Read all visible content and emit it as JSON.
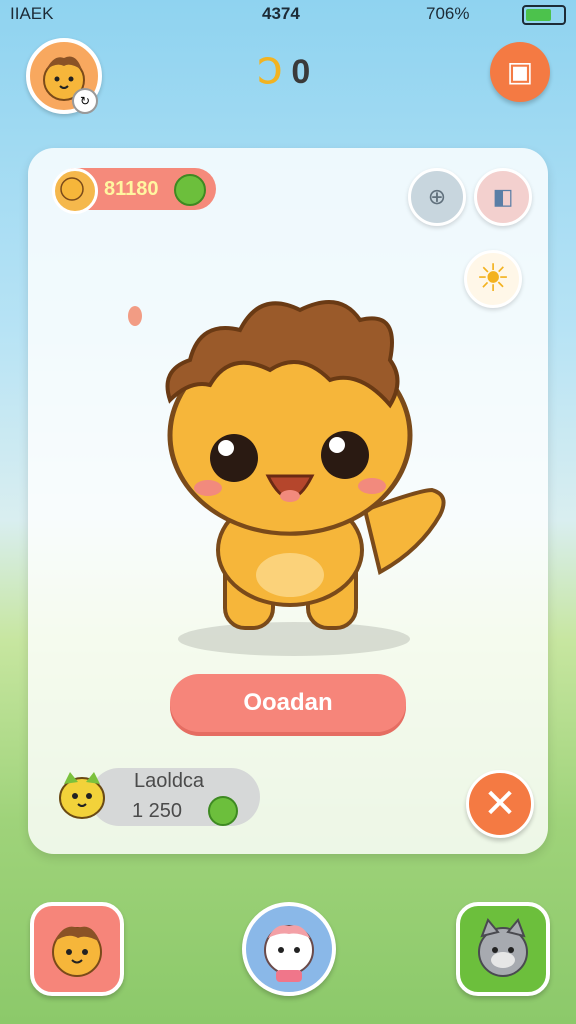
{
  "status_bar": {
    "carrier": "IIAEK",
    "time": "4374",
    "battery": "706%",
    "battery_level": 0.7
  },
  "header": {
    "coins_display_1": "Ↄ",
    "coins_display_2": "0",
    "menu_icon": "book-icon"
  },
  "card": {
    "coin_pill": "81180",
    "primary_button_label": "Ooadan",
    "character_icon": "yellow-bear-character",
    "side_buttons": [
      "compass-icon",
      "shop-icon",
      "sun-icon"
    ]
  },
  "player": {
    "name": "Laoldca",
    "score": "1 250",
    "avatar_icon": "yellow-cat-icon"
  },
  "bottom_nav": [
    "bear-avatar",
    "pig-avatar",
    "gray-cat-avatar"
  ],
  "colors": {
    "accent": "#f6857a",
    "orange": "#f47a43",
    "green": "#6cbf3c",
    "character": "#f6b63a"
  }
}
